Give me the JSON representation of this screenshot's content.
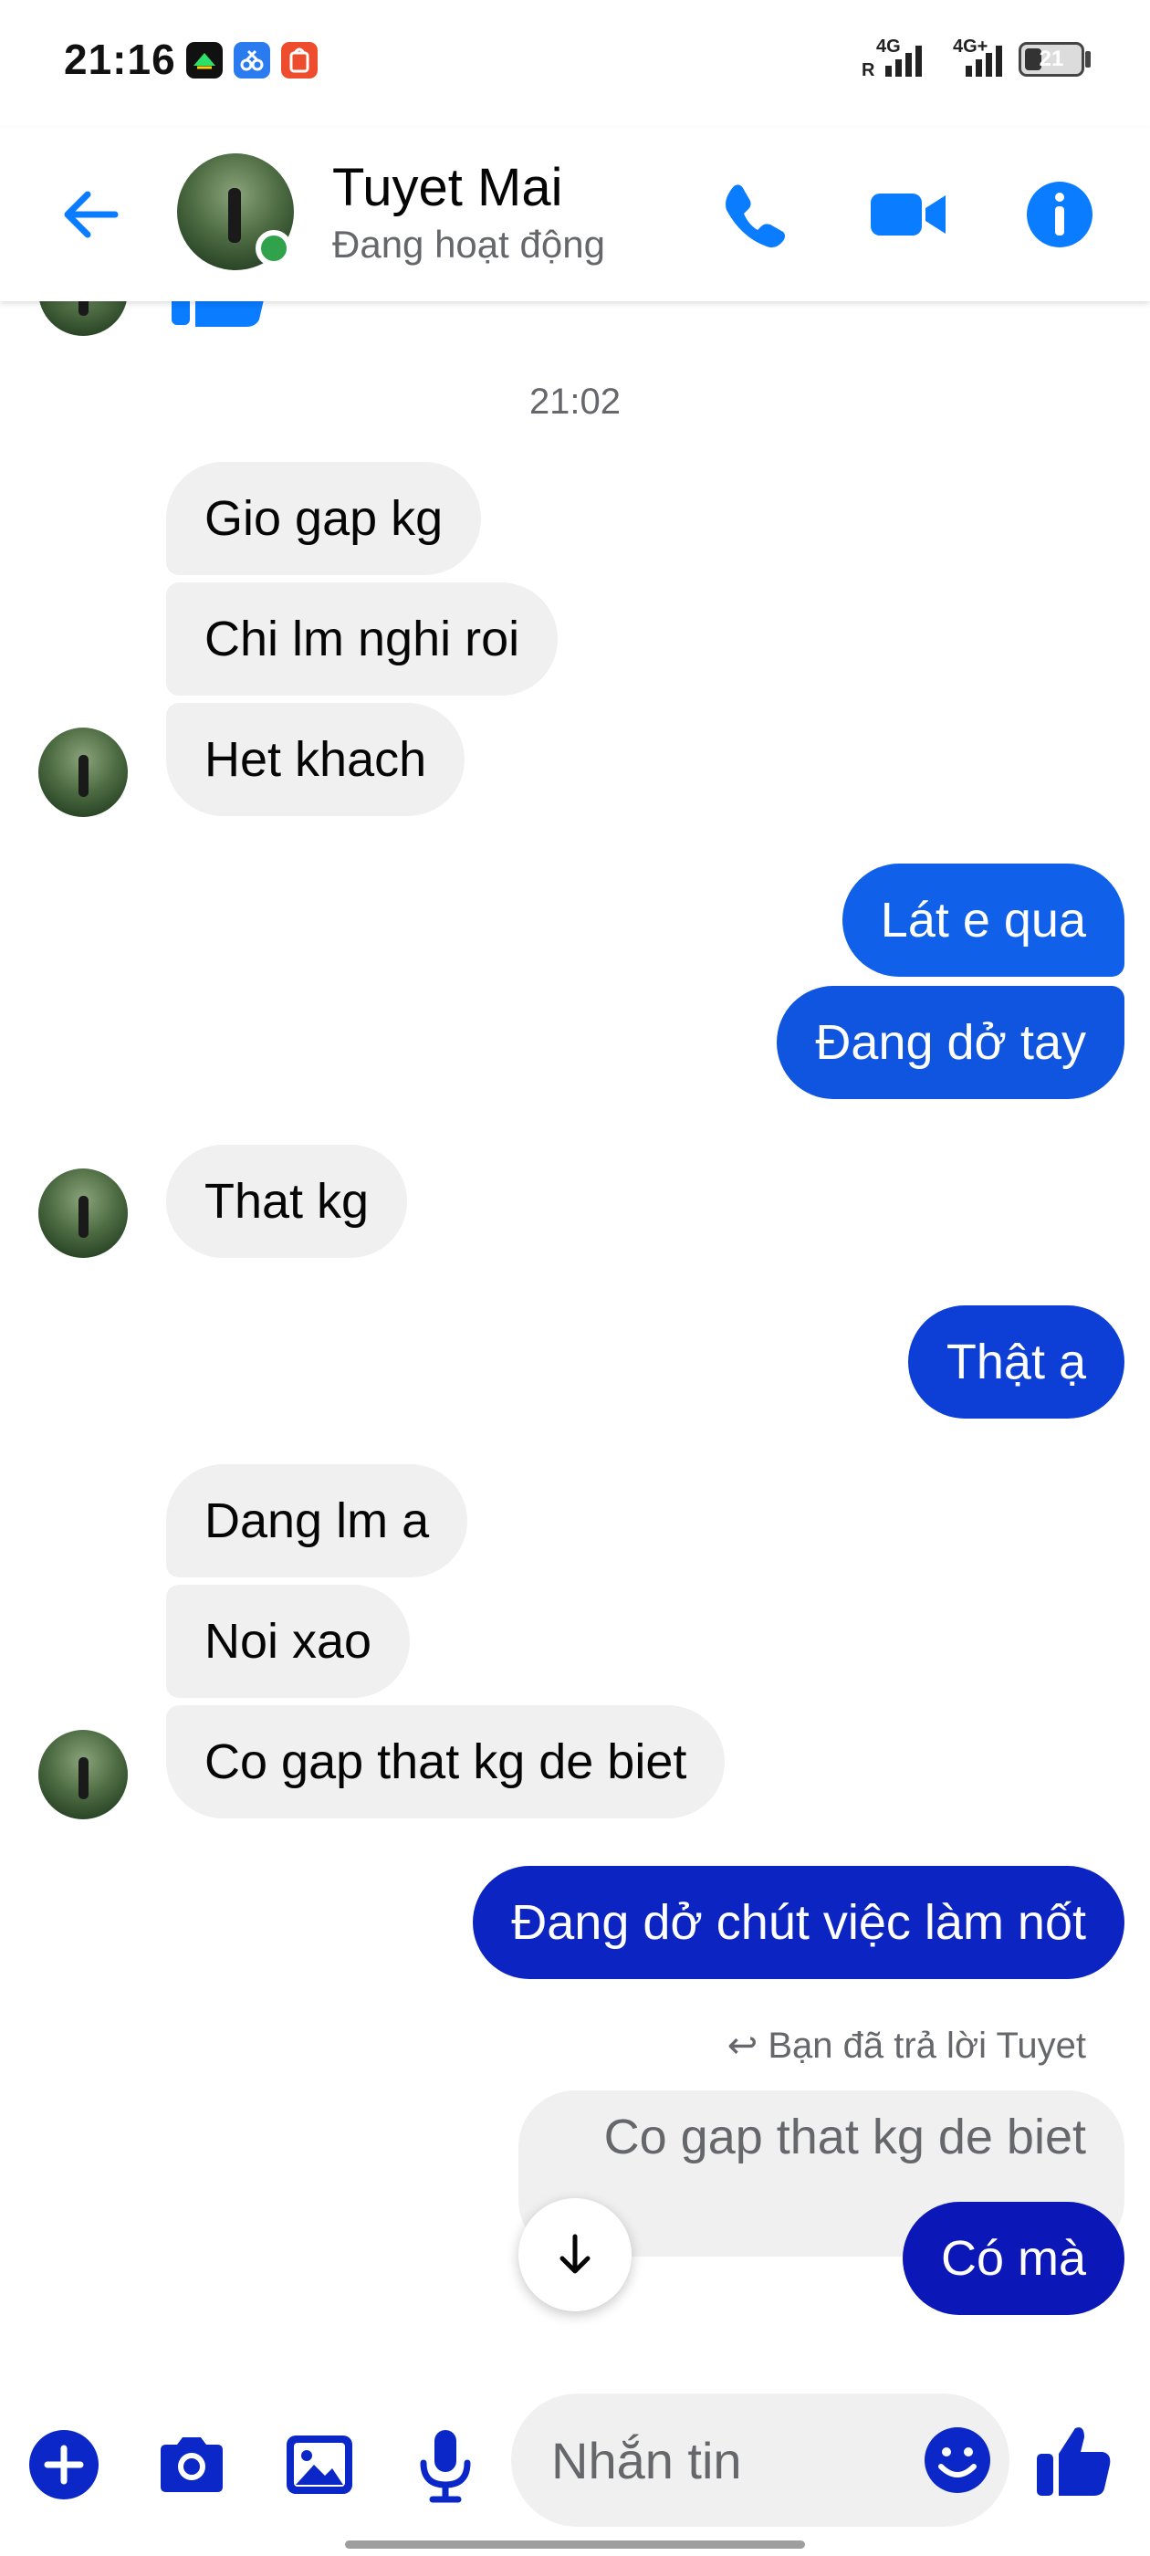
{
  "status_bar": {
    "time": "21:16",
    "app_icons": [
      {
        "icon": "bank-app-icon",
        "color": "#0a7a2e"
      },
      {
        "icon": "photo-editor-app-icon",
        "color": "#2a7bf0"
      },
      {
        "icon": "shopee-app-icon",
        "color": "#ee4d2d"
      }
    ],
    "network_1": "4G",
    "network_1_sub": "R",
    "network_2": "4G+",
    "battery": "21"
  },
  "header": {
    "contact_name": "Tuyet Mai",
    "contact_status": "Đang hoạt động",
    "icons": [
      "back-arrow-icon",
      "phone-icon",
      "video-camera-icon",
      "info-icon"
    ]
  },
  "chat": {
    "timestamp": "21:02",
    "messages": [
      {
        "side": "in",
        "text": "Gio gap kg"
      },
      {
        "side": "in",
        "text": "Chi lm nghi roi"
      },
      {
        "side": "in",
        "text": "Het khach"
      },
      {
        "side": "out",
        "text": "Lát e qua"
      },
      {
        "side": "out",
        "text": "Đang dở tay"
      },
      {
        "side": "in",
        "text": "That kg"
      },
      {
        "side": "out",
        "text": "Thật ạ"
      },
      {
        "side": "in",
        "text": "Dang lm a"
      },
      {
        "side": "in",
        "text": "Noi xao"
      },
      {
        "side": "in",
        "text": "Co gap that kg de biet"
      },
      {
        "side": "out",
        "text": "Đang dở chút việc làm nốt"
      },
      {
        "side": "out",
        "text": "Có mà"
      }
    ],
    "reply_note": "Bạn đã trả lời Tuyet",
    "quoted_text": "Co gap that kg de biet"
  },
  "composer": {
    "placeholder": "Nhắn tin",
    "icons": [
      "plus-icon",
      "camera-icon",
      "gallery-icon",
      "microphone-icon",
      "emoji-icon",
      "thumbs-up-icon"
    ]
  },
  "colors": {
    "accent": "#0a7cff",
    "outgoing_bubble_top": "#1060ea",
    "outgoing_bubble_bottom": "#0c17b8",
    "incoming_bubble": "#f0f0f0",
    "composer_icon": "#0b27c8",
    "online": "#31a24c"
  }
}
